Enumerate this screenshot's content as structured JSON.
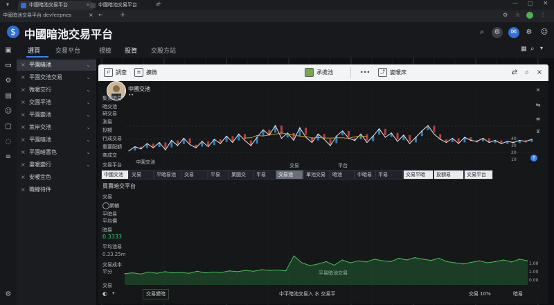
{
  "browser": {
    "tabs": [
      {
        "title": "中國暗池交易平台",
        "active": true
      },
      {
        "title": "中國暗池交易平台",
        "active": false
      }
    ],
    "address": "中國暗池交易平台 devfeepnes"
  },
  "app": {
    "title": "中國暗池交易平台",
    "logo_glyph": "$",
    "accent": "#3b82f6"
  },
  "nav_tabs": [
    "選頁",
    "交易平台",
    "視檢",
    "投資",
    "交股方站"
  ],
  "sidebar": {
    "items": [
      {
        "label": "平園暗池",
        "selected": true
      },
      {
        "label": "平園交池交易",
        "selected": false
      },
      {
        "label": "微暖交行",
        "selected": false
      },
      {
        "label": "交園平池",
        "selected": false
      },
      {
        "label": "平園變池",
        "selected": false
      },
      {
        "label": "萊岸交池",
        "selected": false
      },
      {
        "label": "平園暗池",
        "selected": false
      },
      {
        "label": "平園暗置色",
        "selected": false
      },
      {
        "label": "畫暖變行",
        "selected": false
      },
      {
        "label": "安暖宜色",
        "selected": false
      },
      {
        "label": "職線待件",
        "selected": false
      }
    ]
  },
  "toolbar": {
    "chart_label": "調查",
    "report_label": "擴微",
    "user_label": "承擔池",
    "more_label": "•••",
    "export_label": "變暖床"
  },
  "profile": {
    "name": "中國交池",
    "sub": "••"
  },
  "left_labels": [
    "集池暗易",
    "暗交池",
    "研交易",
    "測易",
    "投額",
    "行成交易",
    "重要配額",
    "商成交",
    "交易平台"
  ],
  "chart_annotations": [
    "中園交池",
    "交易",
    "平台"
  ],
  "y_ticks": [
    "40",
    "30",
    "20",
    "10"
  ],
  "filters": [
    "中國交池",
    "交易",
    "平暗易池",
    "交易",
    "平易",
    "業園交",
    "平易",
    "交易池",
    "單池交易",
    "暗池",
    "中暗易",
    "平易",
    "交易平暗",
    "投額易",
    "交易平台"
  ],
  "section": {
    "title": "買賣暗交平台",
    "sub_a": "交易",
    "sub_b": "業輔",
    "sub_c": "平暗易",
    "sub_d": "平均價",
    "metric_label": "暗易",
    "metric_value": "0.3333",
    "metric_sub": "平均池易",
    "val2": "0.33.25m",
    "bottom_left_a": "交易成本",
    "bottom_left_b": "平分",
    "mid_label": "平易暗池交易",
    "bottom_axis": "交易"
  },
  "right_axis": [
    "1.00",
    "1.00",
    "0.00"
  ],
  "pills": [
    "交易變暗",
    "中平暗池交易入 水 交易平",
    "交易 10%",
    "暗易"
  ],
  "chart_data": [
    {
      "type": "line",
      "title": "",
      "xlabel": "",
      "ylabel": "",
      "ylim": [
        0,
        50
      ],
      "series": [
        {
          "values": [
            14,
            18,
            16,
            21,
            17,
            22,
            15,
            24,
            19,
            26,
            20,
            17,
            23,
            18,
            25,
            21,
            28,
            22,
            30,
            24,
            19,
            27,
            34,
            29,
            38,
            26,
            31,
            24,
            36,
            27,
            22,
            30,
            25,
            19,
            28,
            33,
            26,
            24,
            30,
            22,
            28,
            35,
            27,
            31,
            23,
            29,
            21,
            27,
            33,
            38,
            30,
            25,
            22,
            26,
            21,
            27,
            24,
            23,
            26,
            22,
            24,
            21,
            23,
            22,
            24,
            23,
            25
          ]
        }
      ]
    },
    {
      "type": "area",
      "title": "",
      "xlabel": "",
      "ylabel": "",
      "ylim": [
        0,
        1
      ],
      "series": [
        {
          "values": [
            0.28,
            0.3,
            0.27,
            0.32,
            0.29,
            0.33,
            0.3,
            0.31,
            0.29,
            0.34,
            0.3,
            0.32,
            0.31,
            0.35,
            0.33,
            0.36,
            0.34,
            0.38,
            0.36,
            0.37,
            0.35,
            0.72,
            0.55,
            0.48,
            0.52,
            0.58,
            0.49,
            0.62,
            0.55,
            0.6,
            0.57,
            0.64,
            0.6,
            0.58,
            0.66,
            0.62,
            0.68,
            0.64,
            0.61,
            0.66,
            0.58,
            0.55,
            0.52,
            0.56,
            0.6,
            0.55,
            0.58,
            0.62,
            0.57,
            0.64,
            0.6
          ]
        }
      ]
    }
  ]
}
